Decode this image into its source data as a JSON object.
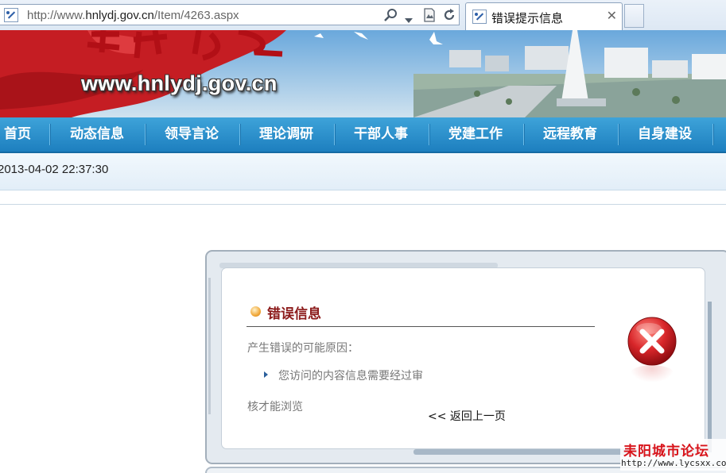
{
  "browser": {
    "url_prefix": "http://www.",
    "url_domain": "hnlydj.gov.cn",
    "url_path": "/Item/4263.aspx",
    "tab_title": "错误提示信息",
    "tab_close": "✕",
    "icons": [
      "favicon-icon",
      "search-icon",
      "dropdown-icon",
      "compatibility-icon",
      "refresh-icon",
      "close-icon"
    ]
  },
  "banner": {
    "site_url": "www.hnlydj.gov.cn"
  },
  "nav": {
    "items": [
      "首页",
      "动态信息",
      "领导言论",
      "理论调研",
      "干部人事",
      "党建工作",
      "远程教育",
      "自身建设"
    ]
  },
  "datebar": {
    "datetime": "2013-04-02 22:37:30"
  },
  "error": {
    "title": "错误信息",
    "reason_label": "产生错误的可能原因：",
    "reason": "您访问的内容信息需要经过审",
    "reason_cont": "核才能浏览",
    "back_link": "<< 返回上一页",
    "icon": "error-x-icon"
  },
  "watermark": {
    "title": "耒阳城市论坛",
    "url": "http://www.lycsxx.com"
  },
  "colors": {
    "nav_bg": "#1d7fbf",
    "error_title": "#8c1b1b",
    "watermark": "#d8141b"
  }
}
